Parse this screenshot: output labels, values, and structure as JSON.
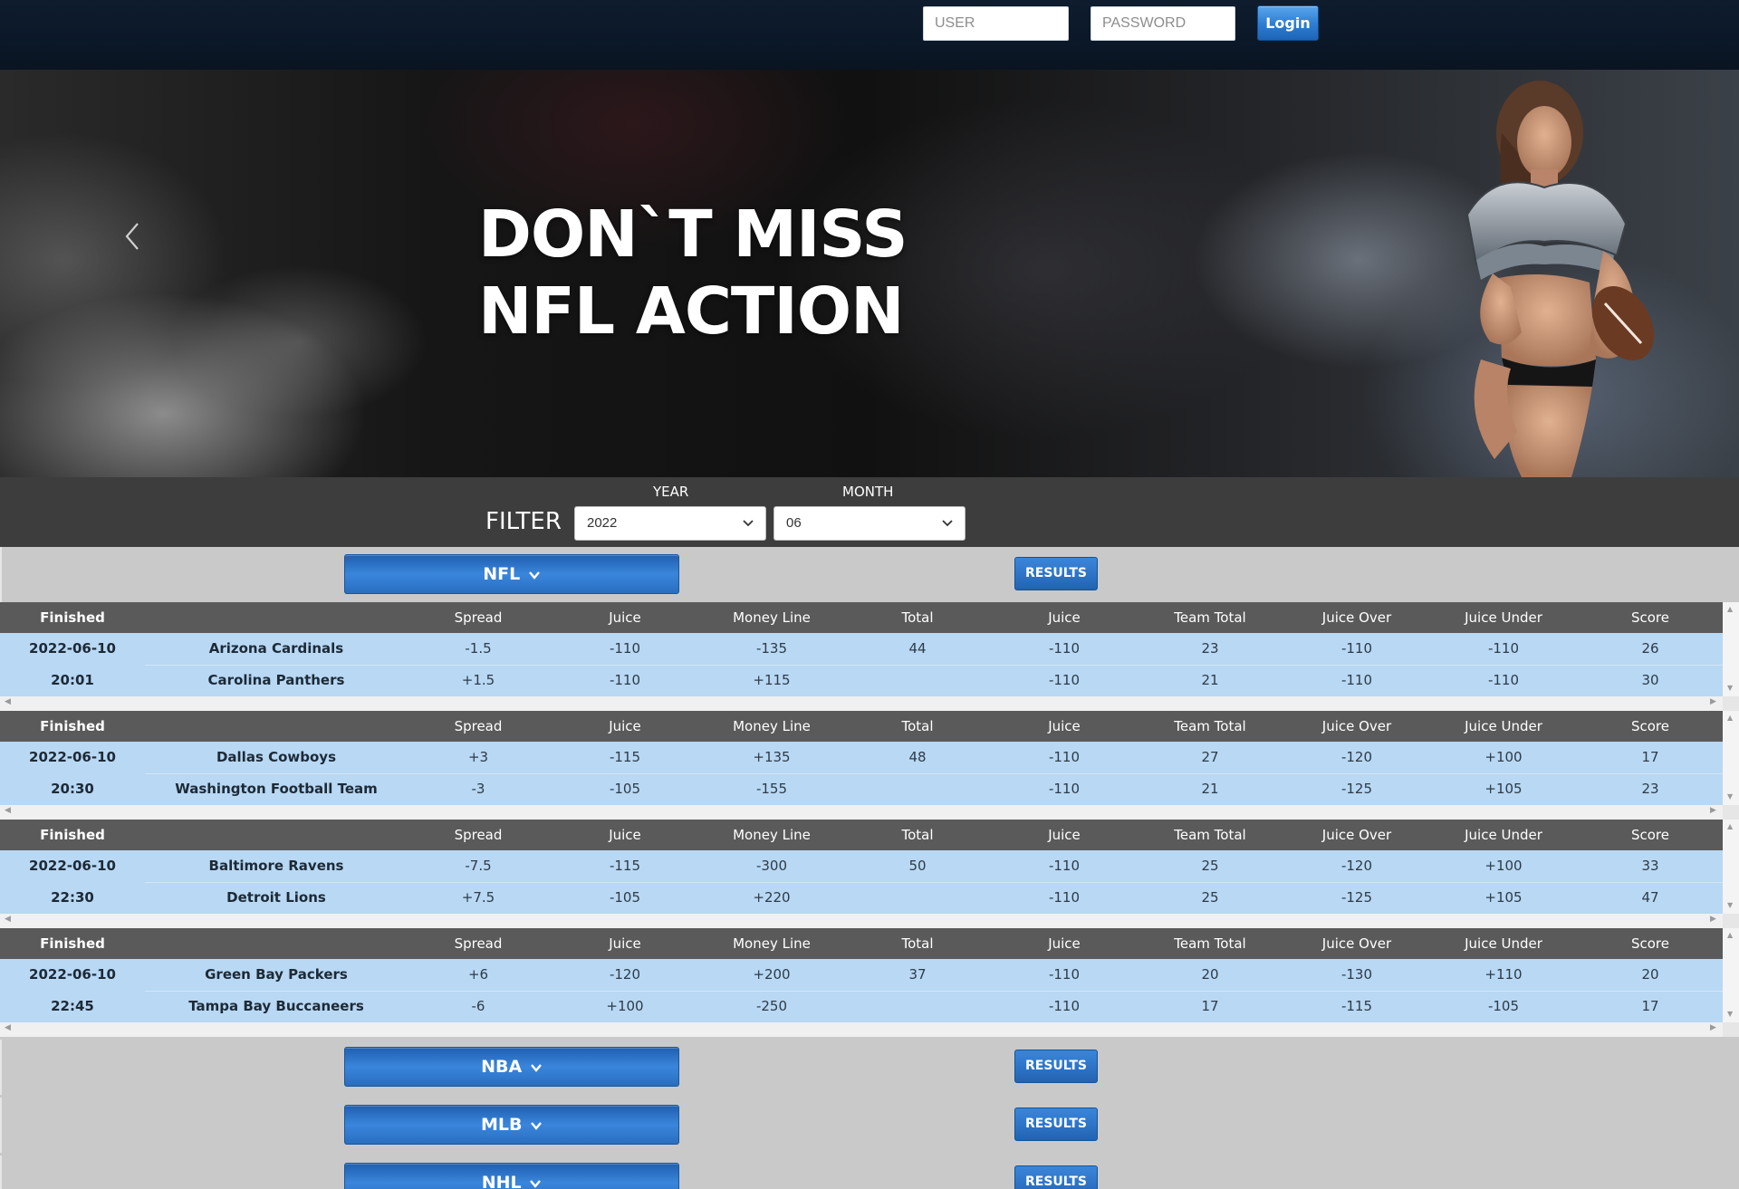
{
  "login": {
    "user_placeholder": "USER",
    "password_placeholder": "PASSWORD",
    "login_label": "Login"
  },
  "hero": {
    "line1": "DON`T MISS",
    "line2": "NFL ACTION"
  },
  "filter": {
    "label": "FILTER",
    "year_label": "YEAR",
    "year_value": "2022",
    "month_label": "MONTH",
    "month_value": "06"
  },
  "columns": {
    "status": "Finished",
    "spread": "Spread",
    "juice": "Juice",
    "money_line": "Money Line",
    "total": "Total",
    "juice2": "Juice",
    "team_total": "Team Total",
    "juice_over": "Juice Over",
    "juice_under": "Juice Under",
    "score": "Score"
  },
  "sports": [
    {
      "name": "NFL",
      "results_label": "RESULTS"
    },
    {
      "name": "NBA",
      "results_label": "RESULTS"
    },
    {
      "name": "MLB",
      "results_label": "RESULTS"
    },
    {
      "name": "NHL",
      "results_label": "RESULTS"
    }
  ],
  "games": [
    {
      "date": "2022-06-10",
      "time": "20:01",
      "total": "44",
      "teams": [
        {
          "name": "Arizona Cardinals",
          "spread": "-1.5",
          "juice": "-110",
          "money_line": "-135",
          "juice2": "-110",
          "team_total": "23",
          "juice_over": "-110",
          "juice_under": "-110",
          "score": "26"
        },
        {
          "name": "Carolina Panthers",
          "spread": "+1.5",
          "juice": "-110",
          "money_line": "+115",
          "juice2": "-110",
          "team_total": "21",
          "juice_over": "-110",
          "juice_under": "-110",
          "score": "30"
        }
      ]
    },
    {
      "date": "2022-06-10",
      "time": "20:30",
      "total": "48",
      "teams": [
        {
          "name": "Dallas Cowboys",
          "spread": "+3",
          "juice": "-115",
          "money_line": "+135",
          "juice2": "-110",
          "team_total": "27",
          "juice_over": "-120",
          "juice_under": "+100",
          "score": "17"
        },
        {
          "name": "Washington Football Team",
          "spread": "-3",
          "juice": "-105",
          "money_line": "-155",
          "juice2": "-110",
          "team_total": "21",
          "juice_over": "-125",
          "juice_under": "+105",
          "score": "23"
        }
      ]
    },
    {
      "date": "2022-06-10",
      "time": "22:30",
      "total": "50",
      "teams": [
        {
          "name": "Baltimore Ravens",
          "spread": "-7.5",
          "juice": "-115",
          "money_line": "-300",
          "juice2": "-110",
          "team_total": "25",
          "juice_over": "-120",
          "juice_under": "+100",
          "score": "33"
        },
        {
          "name": "Detroit Lions",
          "spread": "+7.5",
          "juice": "-105",
          "money_line": "+220",
          "juice2": "-110",
          "team_total": "25",
          "juice_over": "-125",
          "juice_under": "+105",
          "score": "47"
        }
      ]
    },
    {
      "date": "2022-06-10",
      "time": "22:45",
      "total": "37",
      "teams": [
        {
          "name": "Green Bay Packers",
          "spread": "+6",
          "juice": "-120",
          "money_line": "+200",
          "juice2": "-110",
          "team_total": "20",
          "juice_over": "-130",
          "juice_under": "+110",
          "score": "20"
        },
        {
          "name": "Tampa Bay Buccaneers",
          "spread": "-6",
          "juice": "+100",
          "money_line": "-250",
          "juice2": "-110",
          "team_total": "17",
          "juice_over": "-115",
          "juice_under": "-105",
          "score": "17"
        }
      ]
    }
  ],
  "icons": {
    "carousel_prev": "chevron-left-icon",
    "select_arrow": "chevron-down-icon",
    "sport_toggle": "chevron-down-icon"
  },
  "colors": {
    "topbar": "#0b1828",
    "filterbar": "#3d3d3d",
    "table_header": "#5a5a5a",
    "row_bg": "#b8d8f4",
    "button_blue": "#2f78cc"
  }
}
